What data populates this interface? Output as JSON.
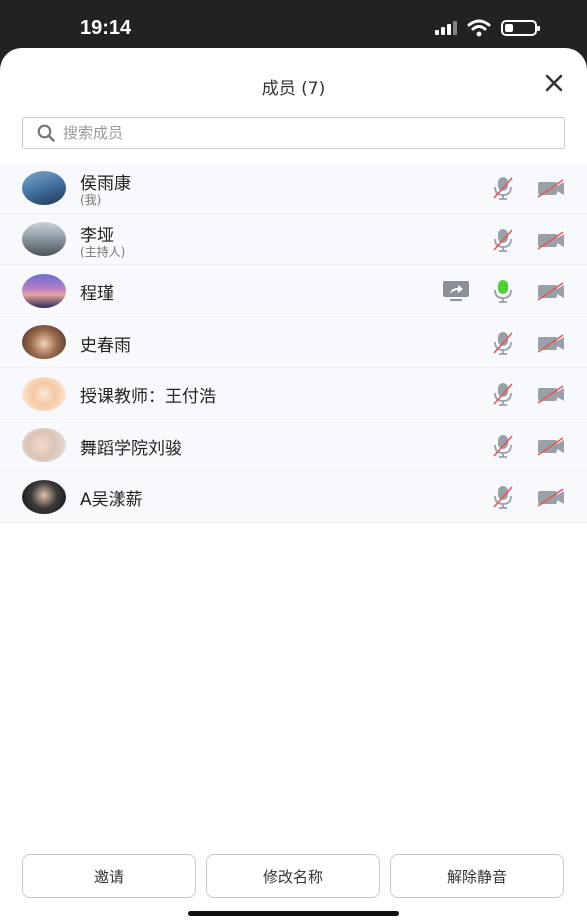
{
  "status_bar": {
    "time": "19:14",
    "battery_level": 0.3
  },
  "header": {
    "title": "成员 (7)"
  },
  "search": {
    "placeholder": "搜索成员"
  },
  "members": [
    {
      "name": "侯雨康",
      "role": "(我)",
      "mic": "muted",
      "camera": "off",
      "sharing": false
    },
    {
      "name": "李垭",
      "role": "(主持人)",
      "mic": "muted",
      "camera": "off",
      "sharing": false
    },
    {
      "name": "程瑾",
      "role": "",
      "mic": "active",
      "camera": "off",
      "sharing": true
    },
    {
      "name": "史春雨",
      "role": "",
      "mic": "muted",
      "camera": "off",
      "sharing": false
    },
    {
      "name": "授课教师：王付浩",
      "role": "",
      "mic": "muted",
      "camera": "off",
      "sharing": false
    },
    {
      "name": "舞蹈学院刘骏",
      "role": "",
      "mic": "muted",
      "camera": "off",
      "sharing": false
    },
    {
      "name": "A吴漾薪",
      "role": "",
      "mic": "muted",
      "camera": "off",
      "sharing": false
    }
  ],
  "footer": {
    "invite": "邀请",
    "rename": "修改名称",
    "unmute": "解除静音"
  },
  "colors": {
    "mic_active": "#4cd137",
    "muted_slash": "#e05a5a",
    "icon_gray": "#9aa0a8"
  }
}
